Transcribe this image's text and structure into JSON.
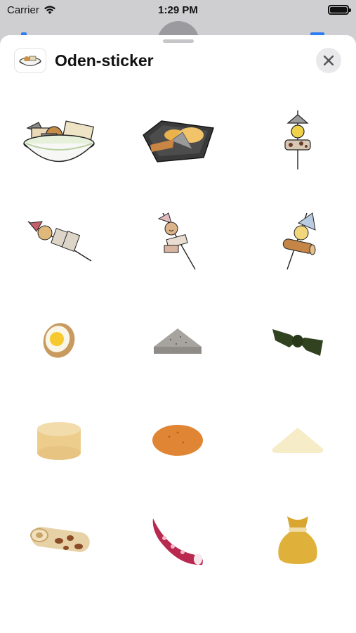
{
  "status_bar": {
    "carrier": "Carrier",
    "time": "1:29 PM",
    "battery_level": 1.0
  },
  "sheet": {
    "title": "Oden-sticker",
    "close_icon": "close-icon"
  },
  "stickers": [
    "bowl-of-oden",
    "tray-of-oden",
    "skewer-konnyaku-egg",
    "skewer-mixed",
    "skewer-smiley",
    "skewer-chikuwa",
    "boiled-egg",
    "konnyaku-triangle",
    "kelp-knot",
    "daikon",
    "fried-fishcake",
    "hanpen",
    "chikuwa",
    "octopus-tentacle",
    "kinchaku-pouch"
  ]
}
